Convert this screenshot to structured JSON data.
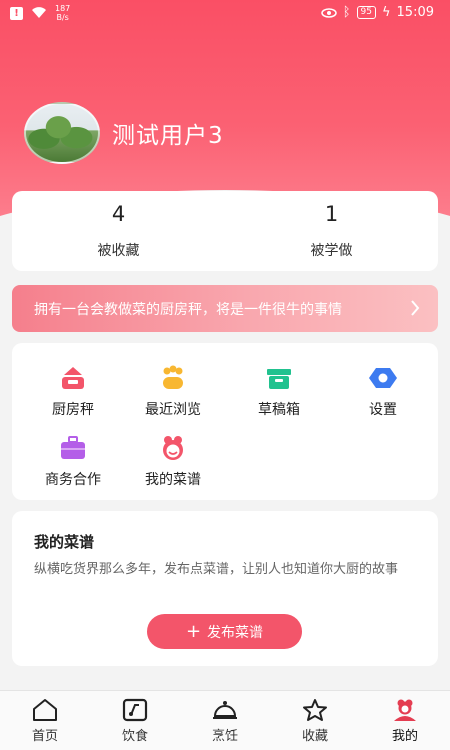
{
  "status_bar": {
    "speed_value": "187",
    "speed_unit": "B/s",
    "battery": "95",
    "time": "15:09"
  },
  "profile": {
    "username": "测试用户3"
  },
  "stats": [
    {
      "count": "4",
      "label": "被收藏"
    },
    {
      "count": "1",
      "label": "被学做"
    }
  ],
  "banner": {
    "text": "拥有一台会教做菜的厨房秤，将是一件很牛的事情"
  },
  "menu": {
    "items": [
      {
        "label": "厨房秤",
        "icon": "kitchen-scale-icon"
      },
      {
        "label": "最近浏览",
        "icon": "paw-icon"
      },
      {
        "label": "草稿箱",
        "icon": "draft-box-icon"
      },
      {
        "label": "设置",
        "icon": "settings-hex-icon"
      },
      {
        "label": "商务合作",
        "icon": "briefcase-icon"
      },
      {
        "label": "我的菜谱",
        "icon": "chef-face-icon"
      }
    ]
  },
  "recipes": {
    "title": "我的菜谱",
    "description": "纵横吃货界那么多年，发布点菜谱，让别人也知道你大厨的故事",
    "publish_label": "发布菜谱"
  },
  "tabs": [
    {
      "label": "首页",
      "icon": "home-icon"
    },
    {
      "label": "饮食",
      "icon": "diet-icon"
    },
    {
      "label": "烹饪",
      "icon": "cloche-icon"
    },
    {
      "label": "收藏",
      "icon": "star-icon"
    },
    {
      "label": "我的",
      "icon": "profile-chef-icon",
      "active": true
    }
  ],
  "colors": {
    "accent": "#f3556a",
    "hero_top": "#fa4f65"
  }
}
